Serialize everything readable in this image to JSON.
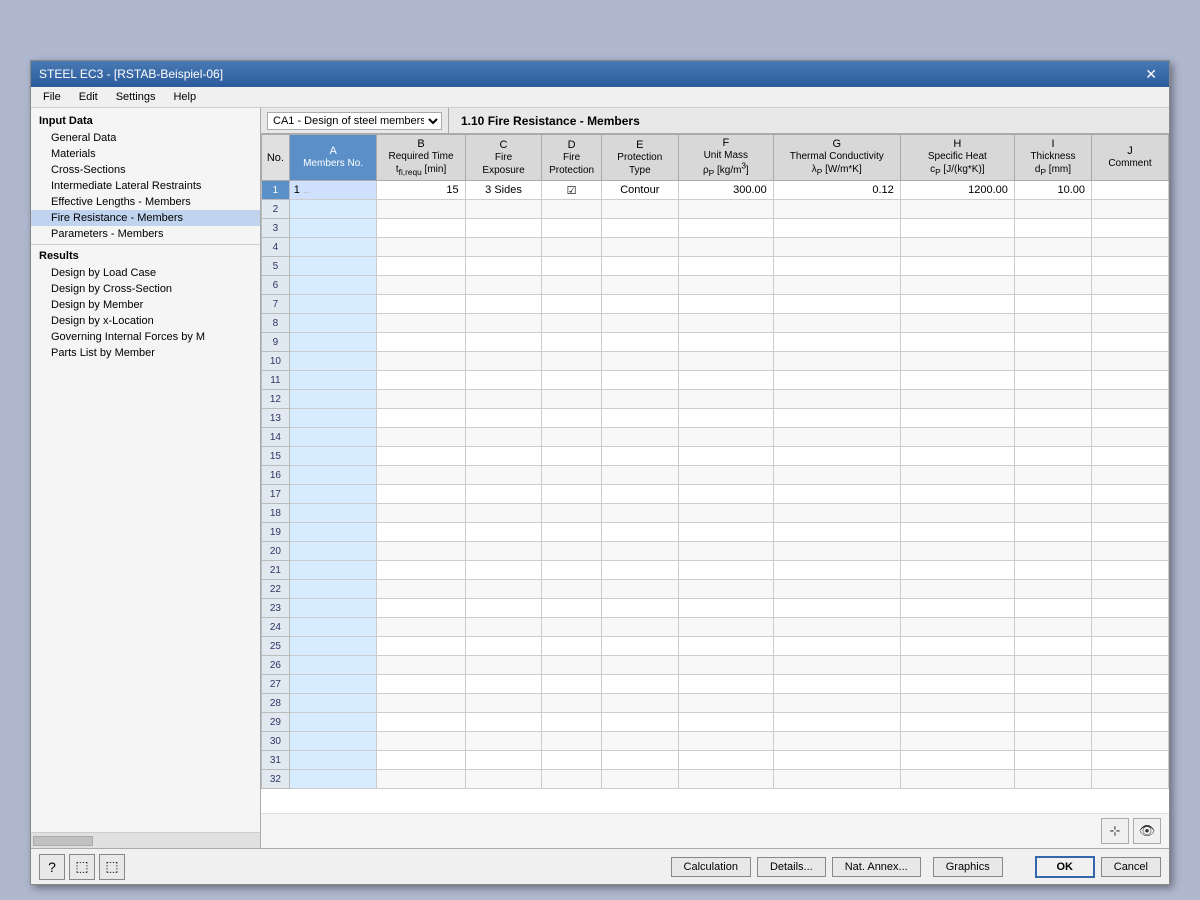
{
  "window": {
    "title": "STEEL EC3 - [RSTAB-Beispiel-06]",
    "close_label": "✕"
  },
  "menu": {
    "items": [
      "File",
      "Edit",
      "Settings",
      "Help"
    ]
  },
  "ca_selector": {
    "label": "CA1 - Design of steel members",
    "options": [
      "CA1 - Design of steel members"
    ]
  },
  "section_title": "1.10 Fire Resistance - Members",
  "sidebar": {
    "input_label": "Input Data",
    "items": [
      {
        "id": "general-data",
        "label": "General Data",
        "indent": 1
      },
      {
        "id": "materials",
        "label": "Materials",
        "indent": 1
      },
      {
        "id": "cross-sections",
        "label": "Cross-Sections",
        "indent": 1
      },
      {
        "id": "intermediate-lateral",
        "label": "Intermediate Lateral Restraints",
        "indent": 1
      },
      {
        "id": "effective-lengths",
        "label": "Effective Lengths - Members",
        "indent": 1
      },
      {
        "id": "fire-resistance",
        "label": "Fire Resistance - Members",
        "indent": 1,
        "active": true
      },
      {
        "id": "parameters",
        "label": "Parameters - Members",
        "indent": 1
      }
    ],
    "results_label": "Results",
    "result_items": [
      {
        "id": "design-by-load",
        "label": "Design by Load Case",
        "indent": 1
      },
      {
        "id": "design-by-cross",
        "label": "Design by Cross-Section",
        "indent": 1
      },
      {
        "id": "design-by-member",
        "label": "Design by Member",
        "indent": 1
      },
      {
        "id": "design-by-x",
        "label": "Design by x-Location",
        "indent": 1
      },
      {
        "id": "governing-internal",
        "label": "Governing Internal Forces by M",
        "indent": 1
      },
      {
        "id": "parts-list",
        "label": "Parts List by Member",
        "indent": 1
      }
    ]
  },
  "table": {
    "columns": [
      {
        "id": "no",
        "label": "No.",
        "sub": ""
      },
      {
        "id": "a",
        "label": "A",
        "sub": "Members No."
      },
      {
        "id": "b",
        "label": "B",
        "sub": "Required Time\nt fi,requ [min]"
      },
      {
        "id": "c",
        "label": "C",
        "sub": "Fire\nExposure"
      },
      {
        "id": "d",
        "label": "D",
        "sub": "Fire\nProtection"
      },
      {
        "id": "e",
        "label": "E",
        "sub": "Protection\nType"
      },
      {
        "id": "f",
        "label": "F",
        "sub": "Unit Mass\nρ P [kg/m³]"
      },
      {
        "id": "g",
        "label": "G",
        "sub": "Thermal Conductivity\nλ P [W/m*K]"
      },
      {
        "id": "h",
        "label": "H",
        "sub": "Specific Heat\nc P [J/(kg*K)]"
      },
      {
        "id": "i",
        "label": "I",
        "sub": "Thickness\nd P [mm]"
      },
      {
        "id": "j",
        "label": "J",
        "sub": "Comment"
      }
    ],
    "row1": {
      "no": "1",
      "a": "1",
      "b": "15",
      "c": "3 Sides",
      "d": "☑",
      "e": "Contour",
      "f": "300.00",
      "g": "0.12",
      "h": "1200.00",
      "i": "10.00",
      "j": ""
    },
    "rows": [
      2,
      3,
      4,
      5,
      6,
      7,
      8,
      9,
      10,
      11,
      12,
      13,
      14,
      15,
      16,
      17,
      18,
      19,
      20,
      21,
      22,
      23,
      24,
      25,
      26,
      27,
      28,
      29,
      30,
      31,
      32
    ]
  },
  "buttons": {
    "calculation": "Calculation",
    "details": "Details...",
    "nat_annex": "Nat. Annex...",
    "graphics": "Graphics",
    "ok": "OK",
    "cancel": "Cancel"
  },
  "toolbar_icons": [
    "?",
    "⬚",
    "⬚"
  ]
}
